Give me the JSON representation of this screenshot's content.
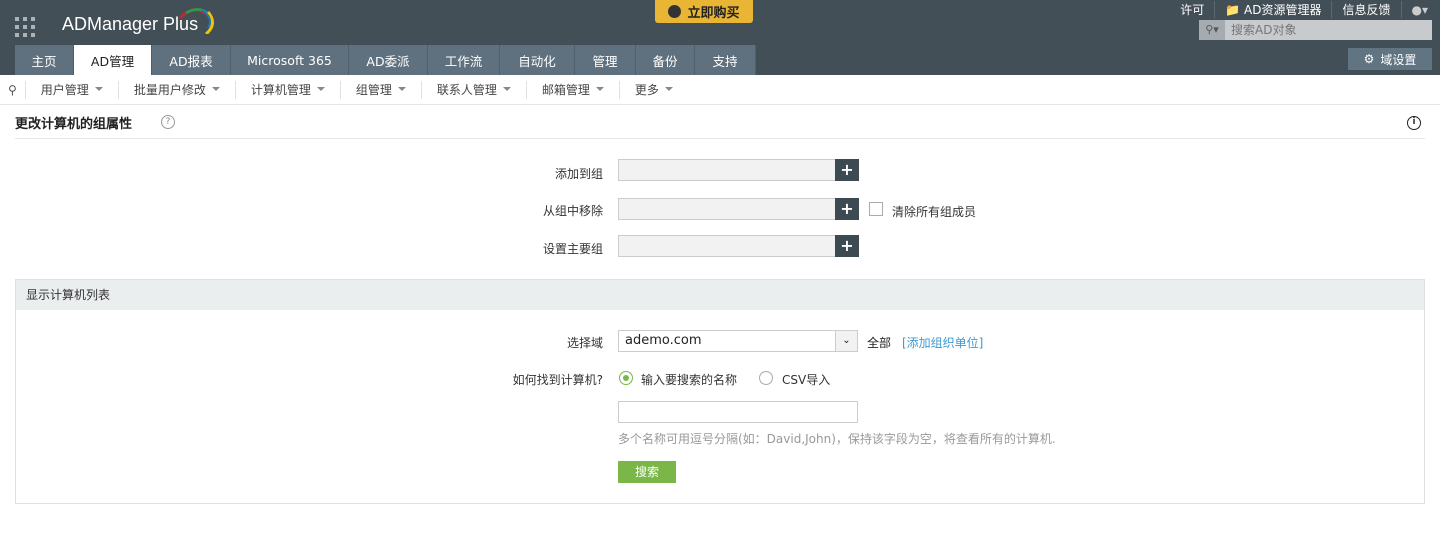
{
  "header": {
    "logo": "ADManager Plus",
    "buy_label": "立即购买",
    "links": [
      "许可",
      "AD资源管理器",
      "信息反馈"
    ],
    "search_placeholder": "搜索AD对象",
    "domain_settings": "域设置"
  },
  "tabs": [
    "主页",
    "AD管理",
    "AD报表",
    "Microsoft 365",
    "AD委派",
    "工作流",
    "自动化",
    "管理",
    "备份",
    "支持"
  ],
  "active_tab": "AD管理",
  "subnav": [
    "用户管理",
    "批量用户修改",
    "计算机管理",
    "组管理",
    "联系人管理",
    "邮箱管理",
    "更多"
  ],
  "page": {
    "title": "更改计算机的组属性",
    "form": {
      "add_label": "添加到组",
      "remove_label": "从组中移除",
      "clear_all_label": "清除所有组成员",
      "primary_label": "设置主要组"
    },
    "panel": {
      "title": "显示计算机列表",
      "domain_label": "选择域",
      "domain_value": "ademo.com",
      "all_label": "全部",
      "add_ou_link": "[添加组织单位]",
      "find_label": "如何找到计算机?",
      "option_name": "输入要搜索的名称",
      "option_csv": "CSV导入",
      "hint": "多个名称可用逗号分隔(如：David,John)，保持该字段为空，将查看所有的计算机.",
      "search_button": "搜索"
    }
  },
  "colors": {
    "header": "#434f57",
    "tab": "#5f717e",
    "accent_green": "#7ab648",
    "buy": "#e8b634",
    "link": "#3d9ad1"
  }
}
